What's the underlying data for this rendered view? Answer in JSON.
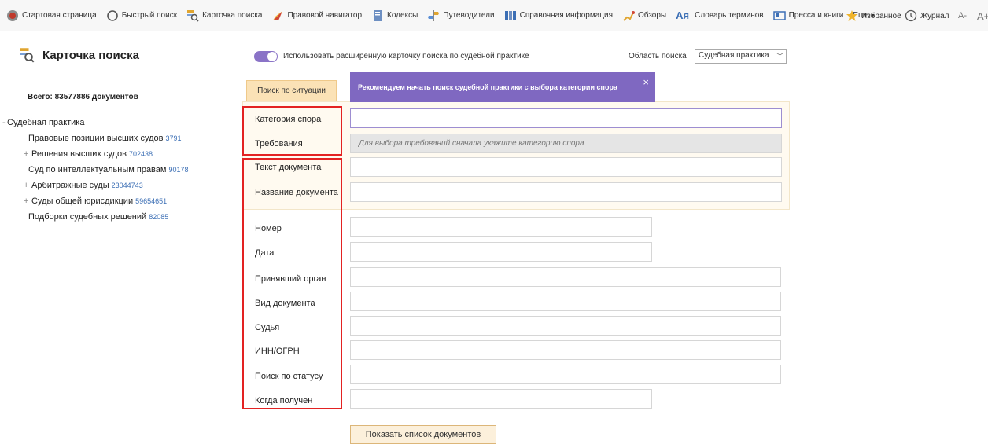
{
  "toolbar": {
    "items": [
      {
        "label": "Стартовая страница",
        "icon": "home-globe-icon"
      },
      {
        "label": "Быстрый поиск",
        "icon": "quick-search-icon"
      },
      {
        "label": "Карточка поиска",
        "icon": "search-card-icon"
      },
      {
        "label": "Правовой навигатор",
        "icon": "legal-navigator-icon"
      },
      {
        "label": "Кодексы",
        "icon": "codes-icon"
      },
      {
        "label": "Путеводители",
        "icon": "guides-icon"
      },
      {
        "label": "Справочная информация",
        "icon": "reference-info-icon"
      },
      {
        "label": "Обзоры",
        "icon": "reviews-icon"
      },
      {
        "label": "Словарь терминов",
        "icon": "dictionary-icon"
      },
      {
        "label": "Пресса и книги",
        "icon": "press-books-icon"
      },
      {
        "label": "Еще",
        "icon": "chevron-down-icon"
      }
    ],
    "favorites_label": "Избранное",
    "journal_label": "Журнал",
    "font_decrease": "A-",
    "font_increase": "A+"
  },
  "left_panel": {
    "title": "Карточка поиска",
    "total": "Всего: 83577886 документов",
    "tree": [
      {
        "label": "Судебная практика",
        "count": "",
        "level": 0,
        "bullet": "-"
      },
      {
        "label": "Правовые позиции высших судов",
        "count": "3791",
        "level": 1,
        "bullet": ""
      },
      {
        "label": "Решения высших судов",
        "count": "702438",
        "level": 1,
        "bullet": "+"
      },
      {
        "label": "Суд по интеллектуальным правам",
        "count": "90178",
        "level": 1,
        "bullet": ""
      },
      {
        "label": "Арбитражные суды",
        "count": "23044743",
        "level": 1,
        "bullet": "+"
      },
      {
        "label": "Суды общей юрисдикции",
        "count": "59654651",
        "level": 1,
        "bullet": "+"
      },
      {
        "label": "Подборки судебных решений",
        "count": "82085",
        "level": 1,
        "bullet": ""
      }
    ]
  },
  "main": {
    "extended_toggle_label": "Использовать расширенную карточку поиска по судебной практике",
    "scope_label": "Область поиска",
    "scope_value": "Судебная практика",
    "tab_situation": "Поиск по ситуации",
    "tooltip": "Рекомендуем начать поиск судебной практики с выбора категории спора",
    "tooltip_close": "×",
    "fields": [
      {
        "label": "Категория спора",
        "placeholder": ""
      },
      {
        "label": "Требования",
        "placeholder": "Для выбора требований сначала укажите категорию спора"
      },
      {
        "label": "Текст документа",
        "placeholder": ""
      },
      {
        "label": "Название документа",
        "placeholder": ""
      },
      {
        "label": "Номер",
        "placeholder": ""
      },
      {
        "label": "Дата",
        "placeholder": ""
      },
      {
        "label": "Принявший орган",
        "placeholder": ""
      },
      {
        "label": "Вид документа",
        "placeholder": ""
      },
      {
        "label": "Судья",
        "placeholder": ""
      },
      {
        "label": "ИНН/ОГРН",
        "placeholder": ""
      },
      {
        "label": "Поиск по статусу",
        "placeholder": ""
      },
      {
        "label": "Когда получен",
        "placeholder": ""
      }
    ],
    "show_button": "Показать список документов"
  },
  "colors": {
    "accent_purple": "#7f68c1",
    "highlight_red": "#e32222",
    "situation_tab": "#fbe2b6",
    "count_blue": "#3c6fb5"
  }
}
